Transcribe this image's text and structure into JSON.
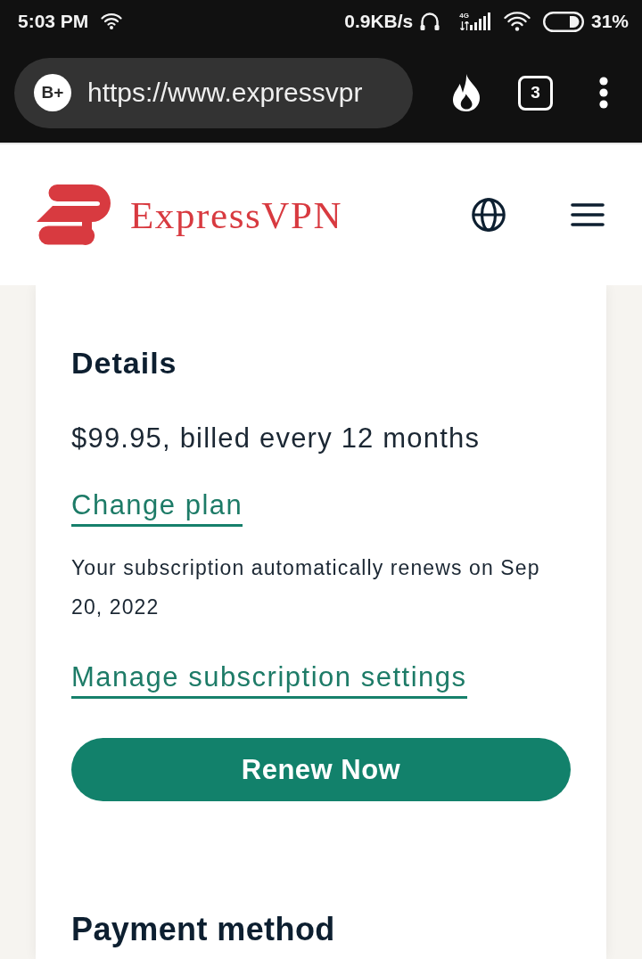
{
  "status_bar": {
    "time": "5:03 PM",
    "data_speed": "0.9KB/s",
    "network_type": "4G",
    "battery": "31%"
  },
  "browser_bar": {
    "site_badge": "B+",
    "url": "https://www.expressvpr",
    "tab_count": "3"
  },
  "site_header": {
    "brand": "ExpressVPN"
  },
  "details": {
    "heading": "Details",
    "price": "$99.95, billed every 12 months",
    "change_plan_link": "Change plan",
    "renewal_note": "Your subscription automatically renews on Sep 20, 2022",
    "manage_link": "Manage subscription settings",
    "renew_button": "Renew Now"
  },
  "payment_method": {
    "heading": "Payment method"
  }
}
